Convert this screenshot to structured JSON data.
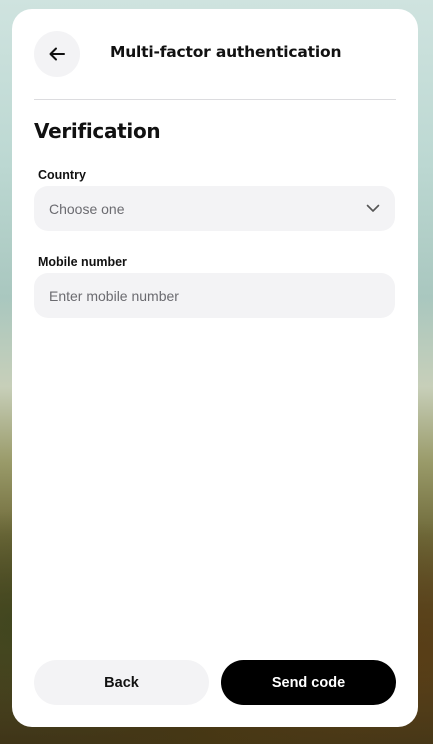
{
  "header": {
    "title": "Multi-factor authentication"
  },
  "section": {
    "title": "Verification"
  },
  "country": {
    "label": "Country",
    "value": "Choose one"
  },
  "mobile": {
    "label": "Mobile number",
    "placeholder": "Enter mobile number"
  },
  "actions": {
    "back_label": "Back",
    "send_label": "Send code"
  },
  "icons": {
    "back": "arrow-left-icon",
    "dropdown": "chevron-down-icon"
  },
  "colors": {
    "primary_button": "#000000",
    "secondary_button": "#f3f3f5",
    "field_bg": "#f3f3f5",
    "card_bg": "#ffffff"
  }
}
